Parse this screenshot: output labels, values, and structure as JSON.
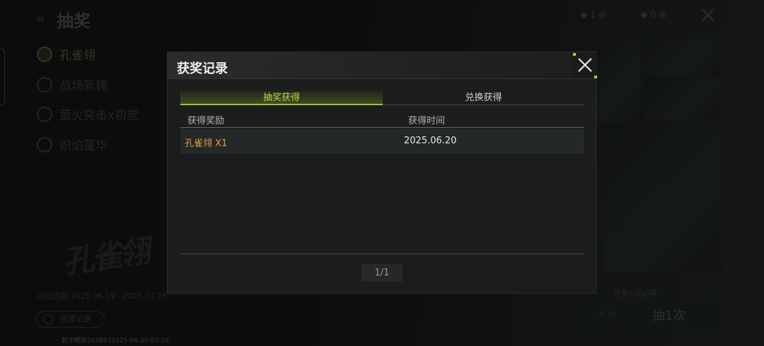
{
  "background": {
    "page_title": "抽奖",
    "currency_1_value": "1",
    "currency_2_value": "0",
    "pools": [
      {
        "label": "孔雀翎",
        "active": true
      },
      {
        "label": "战场新锦",
        "active": false
      },
      {
        "label": "萤火突击x初觉",
        "active": false
      },
      {
        "label": "炽焰蓬华",
        "active": false
      }
    ],
    "logo_text": "孔雀翎",
    "event_dates": "活动日期    2025.06.19 - 2025.07.16",
    "record_button_label": "获奖记录",
    "draw_cost": "x5",
    "draw_button_label": "抽1次",
    "note_text": "还差5次必得",
    "watermark": "数字昵称2838872125-06-20-07:16"
  },
  "modal": {
    "title": "获奖记录",
    "close_icon": "close-icon",
    "tabs": [
      {
        "label": "抽奖获得",
        "active": true
      },
      {
        "label": "兑换获得",
        "active": false
      }
    ],
    "columns": {
      "reward": "获得奖励",
      "time": "获得时间"
    },
    "records": [
      {
        "reward": "孔雀翎 X1",
        "time": "2025.06.20"
      }
    ],
    "pagination": "1/1"
  },
  "colors": {
    "accent_green": "#9ec23a",
    "reward_orange": "#e0a13a"
  }
}
